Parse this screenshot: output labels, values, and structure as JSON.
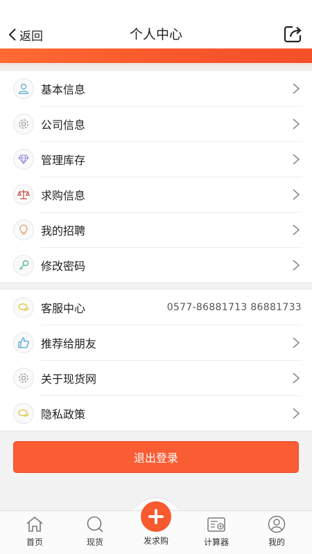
{
  "nav": {
    "back_label": "返回",
    "title": "个人中心"
  },
  "menu_group1": [
    {
      "label": "基本信息",
      "icon": "user-icon",
      "color": "#6fb3d6"
    },
    {
      "label": "公司信息",
      "icon": "gear-icon",
      "color": "#999999"
    },
    {
      "label": "管理库存",
      "icon": "diamond-icon",
      "color": "#9a8ad6"
    },
    {
      "label": "求购信息",
      "icon": "scale-icon",
      "color": "#c0554a"
    },
    {
      "label": "我的招聘",
      "icon": "lightbulb-icon",
      "color": "#e39a6a"
    },
    {
      "label": "修改密码",
      "icon": "key-icon",
      "color": "#4fb89a"
    }
  ],
  "menu_group2": [
    {
      "label": "客服中心",
      "icon": "chat-icon",
      "color": "#e3c23a",
      "extra": "0577-86881713  86881733"
    },
    {
      "label": "推荐给朋友",
      "icon": "thumbs-up-icon",
      "color": "#4aa3d6"
    },
    {
      "label": "关于现货网",
      "icon": "gear-icon",
      "color": "#999999"
    },
    {
      "label": "隐私政策",
      "icon": "chat-icon",
      "color": "#e3c23a"
    }
  ],
  "logout_label": "退出登录",
  "tabbar": {
    "home": "首页",
    "spot": "现货",
    "post": "发求购",
    "calculator": "计算器",
    "mine": "我的"
  },
  "colors": {
    "accent": "#f85a2f",
    "banner": "#f8562b"
  }
}
